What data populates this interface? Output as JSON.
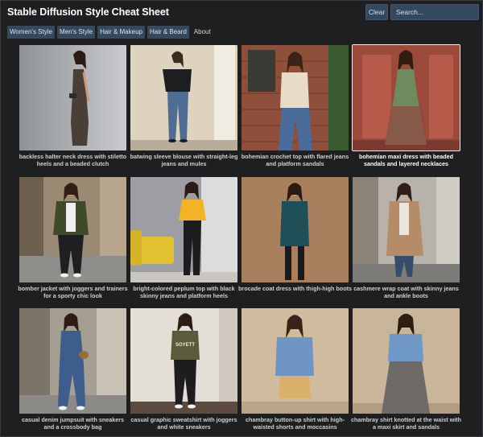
{
  "app": {
    "title": "Stable Diffusion Style Cheat Sheet"
  },
  "toolbar": {
    "clear_label": "Clear",
    "search_placeholder": "Search...",
    "search_value": ""
  },
  "nav": {
    "items": [
      {
        "label": "Women's Style"
      },
      {
        "label": "Men's Style"
      },
      {
        "label": "Hair & Makeup"
      },
      {
        "label": "Hair & Beard"
      },
      {
        "label": "About"
      }
    ]
  },
  "gallery": {
    "cards": [
      {
        "caption": "backless halter neck dress with stiletto heels and a beaded clutch"
      },
      {
        "caption": "batwing sleeve blouse with straight-leg jeans and mules"
      },
      {
        "caption": "bohemian crochet top with flared jeans and platform sandals"
      },
      {
        "caption": "bohemian maxi dress with beaded sandals and layered necklaces"
      },
      {
        "caption": "bomber jacket with joggers and trainers for a sporty chic look"
      },
      {
        "caption": "bright-colored peplum top with black skinny jeans and platform heels"
      },
      {
        "caption": "brocade coat dress with thigh-high boots"
      },
      {
        "caption": "cashmere wrap coat with skinny jeans and ankle boots"
      },
      {
        "caption": "casual denim jumpsuit with sneakers and a crossbody bag"
      },
      {
        "caption": "casual graphic sweatshirt with joggers and white sneakers"
      },
      {
        "caption": "chambray button-up shirt with high-waisted shorts and moccasins"
      },
      {
        "caption": "chambray shirt knotted at the waist with a maxi skirt and sandals"
      }
    ],
    "shirt_print": "SOYETT"
  },
  "colors": {
    "background": "#1e1f21",
    "control": "#34495e"
  }
}
